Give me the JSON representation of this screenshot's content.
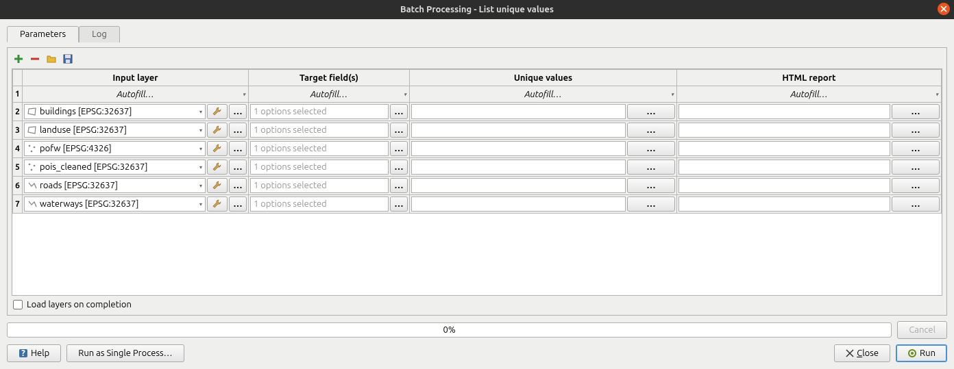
{
  "title": "Batch Processing - List unique values",
  "tabs": {
    "parameters": "Parameters",
    "log": "Log"
  },
  "toolbar": {
    "add": "plus",
    "remove": "minus",
    "open": "folder",
    "save": "disk"
  },
  "columns": {
    "input_layer": "Input layer",
    "target_fields": "Target field(s)",
    "unique_values": "Unique values",
    "html_report": "HTML report"
  },
  "autofill_label": "Autofill…",
  "ellipsis": "…",
  "icon_ellipsis": "…",
  "options_selected_text": "1 options selected",
  "rows": [
    {
      "n": "2",
      "layer": "buildings [EPSG:32637]",
      "geom": "polygon"
    },
    {
      "n": "3",
      "layer": "landuse [EPSG:32637]",
      "geom": "polygon"
    },
    {
      "n": "4",
      "layer": "pofw [EPSG:4326]",
      "geom": "point"
    },
    {
      "n": "5",
      "layer": "pois_cleaned [EPSG:32637]",
      "geom": "point"
    },
    {
      "n": "6",
      "layer": "roads [EPSG:32637]",
      "geom": "line"
    },
    {
      "n": "7",
      "layer": "waterways [EPSG:32637]",
      "geom": "line"
    }
  ],
  "row1_label": "1",
  "load_layers_label": "Load layers on completion",
  "load_layers_checked": false,
  "progress_text": "0%",
  "buttons": {
    "cancel": "Cancel",
    "help": "Help",
    "run_single": "Run as Single Process…",
    "close": "Close",
    "run": "Run"
  }
}
